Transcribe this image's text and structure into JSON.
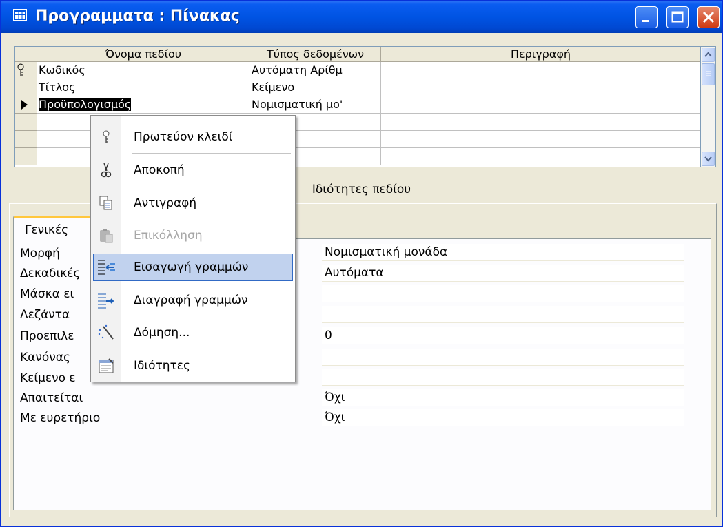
{
  "window": {
    "title": "Προγραμματα : Πίνακας"
  },
  "grid": {
    "columns": [
      "Όνομα πεδίου",
      "Τύπος δεδομένων",
      "Περιγραφή"
    ],
    "rows": [
      {
        "indicator": "key",
        "field": "Κωδικός",
        "type": "Αυτόματη Αρίθμ",
        "description": ""
      },
      {
        "indicator": "",
        "field": "Τίτλος",
        "type": "Κείμενο",
        "description": ""
      },
      {
        "indicator": "current",
        "field": "Προϋπολογισμός",
        "type": "Νομισματική μο'",
        "description": ""
      },
      {
        "indicator": "",
        "field": "",
        "type": "",
        "description": ""
      },
      {
        "indicator": "",
        "field": "",
        "type": "",
        "description": ""
      },
      {
        "indicator": "",
        "field": "",
        "type": "",
        "description": ""
      }
    ]
  },
  "field_properties": {
    "label": "Ιδιότητες πεδίου",
    "tab_general": "Γενικές",
    "items": [
      {
        "name": "Μορφή",
        "value": "Νομισματική μονάδα"
      },
      {
        "name": "Δεκαδικές",
        "value": "Αυτόματα"
      },
      {
        "name": "Μάσκα ει",
        "value": ""
      },
      {
        "name": "Λεζάντα",
        "value": ""
      },
      {
        "name": "Προεπιλε",
        "value": "0"
      },
      {
        "name": "Κανόνας",
        "value": ""
      },
      {
        "name": "Κείμενο ε",
        "value": ""
      },
      {
        "name": "Απαιτείται",
        "value": "Όχι"
      },
      {
        "name": "Με ευρετήριο",
        "value": "Όχι"
      }
    ]
  },
  "context_menu": {
    "items": [
      {
        "label": "Πρωτεύον κλειδί",
        "icon": "key-icon",
        "enabled": true
      },
      {
        "label": "Αποκοπή",
        "icon": "scissors-icon",
        "enabled": true
      },
      {
        "label": "Αντιγραφή",
        "icon": "copy-icon",
        "enabled": true
      },
      {
        "label": "Επικόλληση",
        "icon": "paste-icon",
        "enabled": false
      },
      {
        "label": "Εισαγωγή γραμμών",
        "icon": "insert-rows-icon",
        "enabled": true,
        "highlighted": true
      },
      {
        "label": "Διαγραφή γραμμών",
        "icon": "delete-rows-icon",
        "enabled": true
      },
      {
        "label": "Δόμηση...",
        "icon": "build-wand-icon",
        "enabled": true
      },
      {
        "label": "Ιδιότητες",
        "icon": "properties-icon",
        "enabled": true
      }
    ]
  },
  "colors": {
    "title_bar": "#0054e3",
    "menu_highlight": "#c1d2ee",
    "selection": "#000000"
  }
}
